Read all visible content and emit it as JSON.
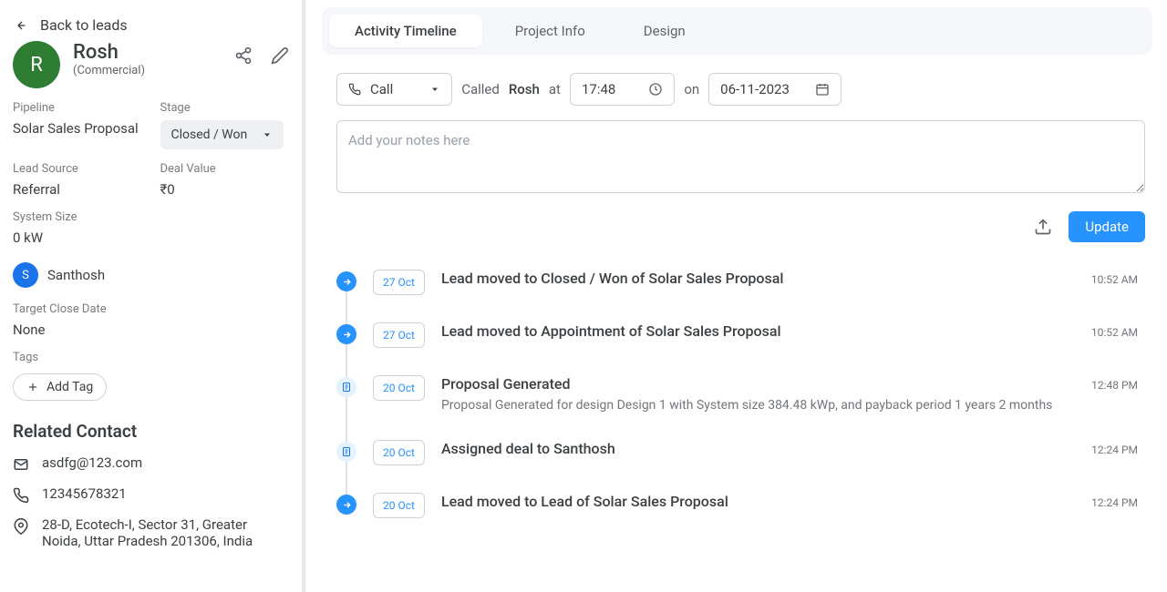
{
  "nav": {
    "back_label": "Back to leads"
  },
  "lead": {
    "initial": "R",
    "name": "Rosh",
    "type": "(Commercial)"
  },
  "fields": {
    "pipeline_label": "Pipeline",
    "pipeline_value": "Solar Sales Proposal",
    "stage_label": "Stage",
    "stage_value": "Closed / Won",
    "lead_source_label": "Lead Source",
    "lead_source_value": "Referral",
    "deal_value_label": "Deal Value",
    "deal_value_value": "₹0",
    "system_size_label": "System Size",
    "system_size_value": "0 kW",
    "target_close_label": "Target Close Date",
    "target_close_value": "None",
    "tags_label": "Tags",
    "add_tag_label": "Add Tag"
  },
  "owner": {
    "initial": "S",
    "name": "Santhosh"
  },
  "related_contact": {
    "heading": "Related Contact",
    "email": "asdfg@123.com",
    "phone": "12345678321",
    "address": "28-D, Ecotech-I, Sector 31, Greater Noida, Uttar Pradesh 201306, India"
  },
  "tabs": {
    "activity": "Activity Timeline",
    "project": "Project Info",
    "design": "Design"
  },
  "log": {
    "type": "Call",
    "called_label": "Called",
    "callee": "Rosh",
    "at_label": "at",
    "time": "17:48",
    "on_label": "on",
    "date": "06-11-2023",
    "notes_placeholder": "Add your notes here",
    "update_label": "Update"
  },
  "timeline": [
    {
      "icon": "arrow",
      "date": "27 Oct",
      "title": "Lead moved to Closed / Won of Solar Sales Proposal",
      "desc": "",
      "time": "10:52 AM"
    },
    {
      "icon": "arrow",
      "date": "27 Oct",
      "title": "Lead moved to Appointment of Solar Sales Proposal",
      "desc": "",
      "time": "10:52 AM"
    },
    {
      "icon": "doc",
      "date": "20 Oct",
      "title": "Proposal Generated",
      "desc": "Proposal Generated for design Design 1 with System size 384.48 kWp, and payback period 1 years 2 months",
      "time": "12:48 PM"
    },
    {
      "icon": "doc",
      "date": "20 Oct",
      "title": "Assigned deal to Santhosh",
      "desc": "",
      "time": "12:24 PM"
    },
    {
      "icon": "arrow",
      "date": "20 Oct",
      "title": "Lead moved to Lead of Solar Sales Proposal",
      "desc": "",
      "time": "12:24 PM"
    }
  ]
}
